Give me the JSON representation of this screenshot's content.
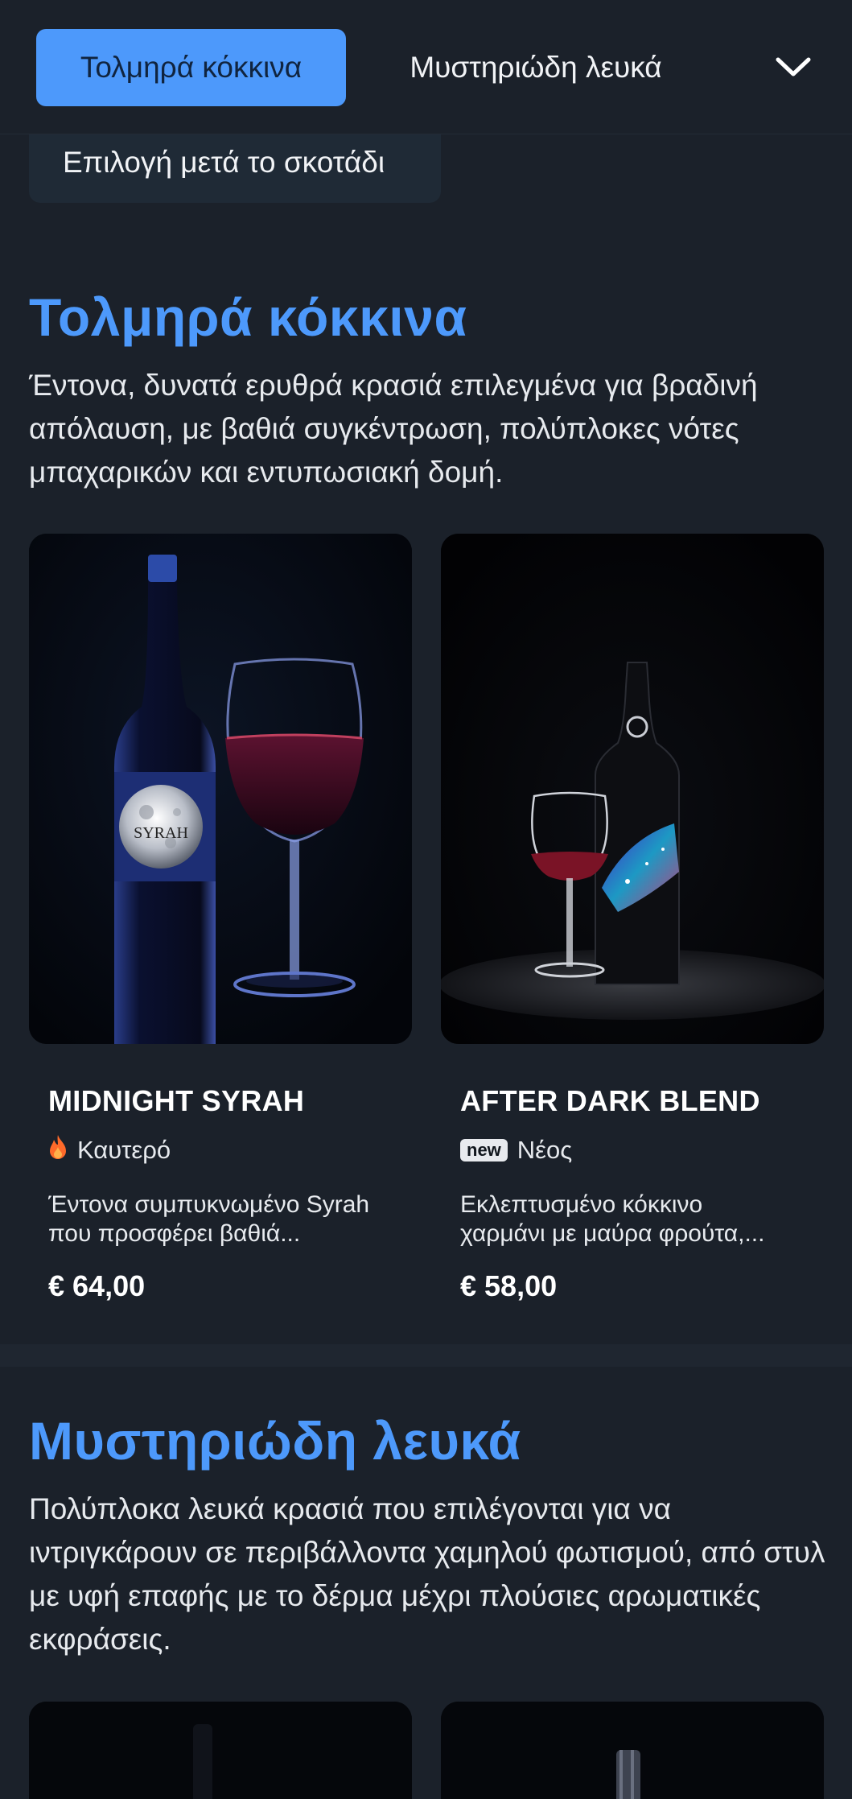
{
  "nav": {
    "tabs": [
      "Τολμηρά κόκκινα",
      "Μυστηριώδη λευκά"
    ],
    "active_index": 0,
    "next_pill": "Επιλογή μετά το σκοτάδι",
    "expand_icon": "chevron-down-icon"
  },
  "sections": [
    {
      "title": "Τολμηρά κόκκινα",
      "description": "Έντονα, δυνατά ερυθρά κρασιά επιλεγμένα για βραδινή απόλαυση, με βαθιά συγκέντρωση, πολύπλοκες νότες μπαχαρικών και εντυπωσιακή δομή.",
      "products": [
        {
          "name": "MIDNIGHT SYRAH",
          "badge_icon": "flame-icon",
          "badge_label": "Καυτερό",
          "description_line1": "Έντονα συμπυκνωμένο Syrah",
          "description_line2": "που προσφέρει βαθιά...",
          "price": "€ 64,00",
          "label_text": "SYRAH"
        },
        {
          "name": "AFTER DARK BLEND",
          "badge_pill": "new",
          "badge_label": "Νέος",
          "description_line1": "Εκλεπτυσμένο κόκκινο",
          "description_line2": "χαρμάνι με μαύρα φρούτα,...",
          "price": "€ 58,00"
        }
      ]
    },
    {
      "title": "Μυστηριώδη λευκά",
      "description": "Πολύπλοκα λευκά κρασιά που επιλέγονται για να ιντριγκάρουν σε περιβάλλοντα χαμηλού φωτισμού, από στυλ με υφή επαφής με το δέρμα μέχρι πλούσιες αρωματικές εκφράσεις."
    }
  ],
  "colors": {
    "background": "#1b212a",
    "accent": "#4d99fb",
    "text": "#f1f3f6",
    "flame": "#ff6a2a"
  }
}
